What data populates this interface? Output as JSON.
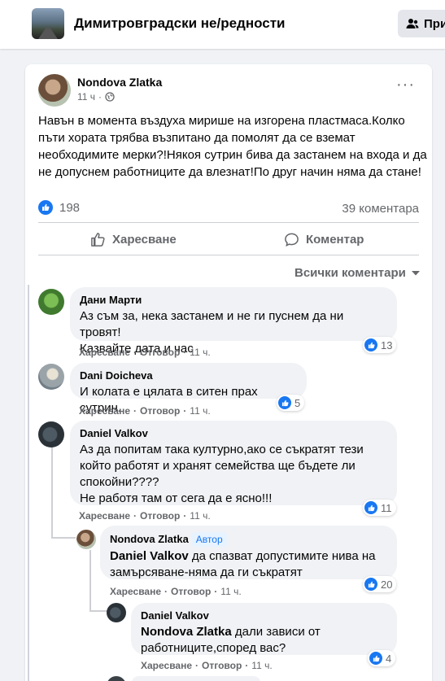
{
  "header": {
    "group_name": "Димитровградски не/редности",
    "join_label": "При"
  },
  "post": {
    "author": "Nondova Zlatka",
    "time": "11 ч",
    "privacy": "·",
    "text": "Навън в момента въздуха мирише на изгорена пластмаса.Колко пъти хората трябва възпитано да помолят да се вземат необходимите мерки?!Някоя сутрин бива да застанем на входа и да не допуснем работниците да влезнат!По друг начин няма да стане!",
    "reaction_count": "198",
    "comment_count": "39 коментара",
    "like_label": "Харесване",
    "comment_label": "Коментар",
    "filter_label": "Всички коментари"
  },
  "comments": [
    {
      "name": "Дани Марти",
      "lines": [
        "Аз съм за, нека застанем и не ги пуснем да ни тровят!",
        "Казвайте дата и час"
      ],
      "like": "Харесване",
      "reply": "Отговор",
      "time": "11 ч.",
      "likes": "13"
    },
    {
      "name": "Dani Doicheva",
      "lines": [
        "И колата е цялата в ситен прах сутрин."
      ],
      "like": "Харесване",
      "reply": "Отговор",
      "time": "11 ч.",
      "likes": "5"
    },
    {
      "name": "Daniel Valkov",
      "lines": [
        "Аз да попитам така културно,ако се съкратят тези",
        "който работят и хранят семейства ще бъдете ли",
        "спокойни????",
        "Не работя там от сега да е ясно!!!"
      ],
      "like": "Харесване",
      "reply": "Отговор",
      "time": "11 ч.",
      "likes": "11"
    }
  ],
  "replies": [
    {
      "name": "Nondova Zlatka",
      "badge": "Автор",
      "mention": "Daniel Valkov",
      "text_after": " да спазват допустимите нива на",
      "line2": "замърсяване-няма да ги съкратят",
      "like": "Харесване",
      "reply": "Отговор",
      "time": "11 ч.",
      "likes": "20"
    },
    {
      "name": "Daniel Valkov",
      "mention": "Nondova Zlatka",
      "text_after": " дали зависи от",
      "line2": "работниците,според вас?",
      "like": "Харесване",
      "reply": "Отговор",
      "time": "11 ч.",
      "likes": "4"
    }
  ],
  "colors": {
    "accent": "#1877f2",
    "background": "#f0f2f5",
    "secondary_text": "#65676b"
  }
}
